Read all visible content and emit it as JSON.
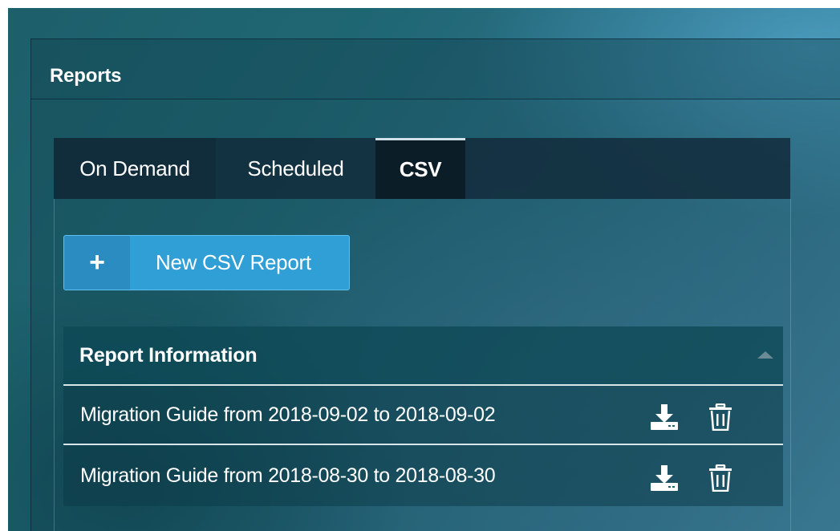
{
  "panel": {
    "title": "Reports"
  },
  "tabs": [
    {
      "label": "On Demand",
      "active": false
    },
    {
      "label": "Scheduled",
      "active": false
    },
    {
      "label": "CSV",
      "active": true
    }
  ],
  "actions": {
    "new_report_label": "New CSV Report",
    "new_report_icon": "plus-icon"
  },
  "report_section": {
    "title": "Report Information",
    "toggle_icon": "caret-up-icon",
    "rows": [
      {
        "label": "Migration Guide from 2018-09-02 to 2018-09-02",
        "icons": [
          "download-icon",
          "trash-icon"
        ]
      },
      {
        "label": "Migration Guide from 2018-08-30 to 2018-08-30",
        "icons": [
          "download-icon",
          "trash-icon"
        ]
      }
    ]
  },
  "colors": {
    "accent": "#2f9fd6",
    "tab_active_bg": "#0b1d27",
    "tabbar_bg": "#122c3c",
    "text": "#ffffff"
  }
}
